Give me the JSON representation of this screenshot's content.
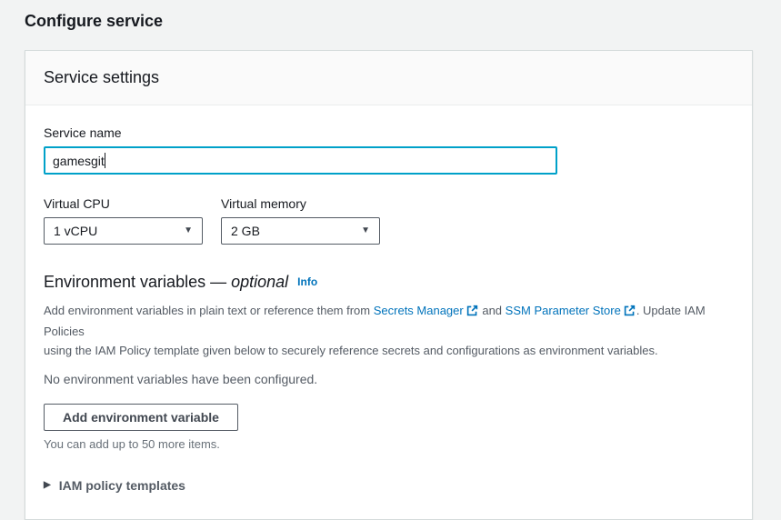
{
  "page": {
    "title": "Configure service"
  },
  "card": {
    "header": "Service settings",
    "service_name": {
      "label": "Service name",
      "value": "gamesgit"
    },
    "cpu": {
      "label": "Virtual CPU",
      "selected": "1 vCPU"
    },
    "memory": {
      "label": "Virtual memory",
      "selected": "2 GB"
    },
    "env": {
      "heading": "Environment variables",
      "dash": " — ",
      "optional": "optional",
      "info_label": "Info",
      "desc_pre": "Add environment variables in plain text or reference them from ",
      "link_secrets": "Secrets Manager",
      "desc_and": " and ",
      "link_ssm": "SSM Parameter Store",
      "desc_post": ". Update IAM Policies",
      "desc_line2": "using the IAM Policy template given below to securely reference secrets and configurations as environment variables.",
      "empty_message": "No environment variables have been configured.",
      "add_button": "Add environment variable",
      "limit_note": "You can add up to 50 more items.",
      "expander_label": "IAM policy templates"
    }
  },
  "icons": {
    "dropdown_caret": "▼",
    "expander_triangle": "▶",
    "external_link": "external-link"
  },
  "colors": {
    "link": "#0073bb",
    "focus_border": "#00a1c9",
    "page_background": "#f2f3f3",
    "card_header_background": "#fafafa",
    "border_gray": "#545b64"
  }
}
